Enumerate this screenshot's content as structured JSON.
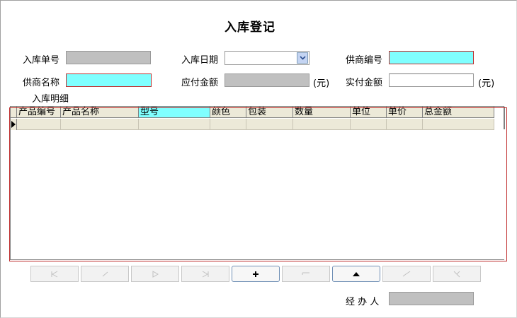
{
  "title": "入库登记",
  "form": {
    "order_no_label": "入库单号",
    "date_label": "入库日期",
    "supplier_no_label": "供商编号",
    "supplier_name_label": "供商名称",
    "payable_label": "应付金额",
    "paid_label": "实付金额",
    "unit_yuan": "(元)",
    "detail_label": "入库明细",
    "handler_label": "经 办 人",
    "handler_value": "",
    "order_no_value": "",
    "date_value": "",
    "supplier_no_value": "",
    "supplier_name_value": "",
    "payable_value": "",
    "paid_value": ""
  },
  "grid": {
    "columns": [
      "产品编号",
      "产品名称",
      "型号",
      "颜色",
      "包装",
      "数量",
      "单位",
      "单价",
      "总金额"
    ],
    "rows": [
      [
        "",
        "",
        "",
        "",
        "",
        "",
        "",
        "",
        ""
      ]
    ]
  },
  "nav": {
    "buttons": [
      {
        "name": "first-button",
        "glyph": "|◀",
        "enabled": false
      },
      {
        "name": "prev-button",
        "glyph": "◀",
        "enabled": false
      },
      {
        "name": "next-button",
        "glyph": "▶",
        "enabled": false
      },
      {
        "name": "last-button",
        "glyph": "▶|",
        "enabled": false
      },
      {
        "name": "add-button",
        "glyph": "+",
        "enabled": true
      },
      {
        "name": "delete-button",
        "glyph": "—",
        "enabled": false
      },
      {
        "name": "edit-button",
        "glyph": "▲",
        "enabled": true
      },
      {
        "name": "save-button",
        "glyph": "✓",
        "enabled": false
      },
      {
        "name": "cancel-button",
        "glyph": "✕",
        "enabled": false
      }
    ]
  },
  "colors": {
    "required_field": "#80ffff",
    "readonly_field": "#c0c0c0",
    "highlight_border": "#c03030"
  }
}
